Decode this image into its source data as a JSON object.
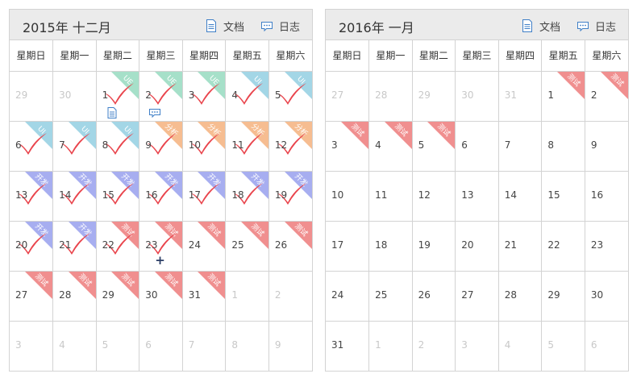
{
  "colors": {
    "UE": "#a6e0c9",
    "UI": "#a3d6e6",
    "分析": "#f6bd91",
    "开发": "#a7aef0",
    "测试": "#f08f8f",
    "check": "#e9444c"
  },
  "icons": {
    "document": "document-icon",
    "log": "chat-bubble-icon",
    "check": "check-mark-icon",
    "plus": "plus-icon"
  },
  "weekdays": [
    "星期日",
    "星期一",
    "星期二",
    "星期三",
    "星期四",
    "星期五",
    "星期六"
  ],
  "calendars": [
    {
      "title": "2015年 十二月",
      "doc_label": "文档",
      "log_label": "日志",
      "weeks": [
        [
          {
            "d": "29",
            "other": true
          },
          {
            "d": "30",
            "other": true
          },
          {
            "d": "1",
            "tag": "UE",
            "check": true,
            "doc": true
          },
          {
            "d": "2",
            "tag": "UE",
            "check": true,
            "log": true
          },
          {
            "d": "3",
            "tag": "UE",
            "check": true
          },
          {
            "d": "4",
            "tag": "UI",
            "check": true
          },
          {
            "d": "5",
            "tag": "UI",
            "check": true
          }
        ],
        [
          {
            "d": "6",
            "tag": "UI",
            "check": true
          },
          {
            "d": "7",
            "tag": "UI",
            "check": true
          },
          {
            "d": "8",
            "tag": "UI",
            "check": true
          },
          {
            "d": "9",
            "tag": "分析",
            "check": true
          },
          {
            "d": "10",
            "tag": "分析",
            "check": true
          },
          {
            "d": "11",
            "tag": "分析",
            "check": true
          },
          {
            "d": "12",
            "tag": "分析",
            "check": true
          }
        ],
        [
          {
            "d": "13",
            "tag": "开发",
            "check": true
          },
          {
            "d": "14",
            "tag": "开发",
            "check": true
          },
          {
            "d": "15",
            "tag": "开发",
            "check": true
          },
          {
            "d": "16",
            "tag": "开发",
            "check": true
          },
          {
            "d": "17",
            "tag": "开发",
            "check": true
          },
          {
            "d": "18",
            "tag": "开发",
            "check": true
          },
          {
            "d": "19",
            "tag": "开发",
            "check": true
          }
        ],
        [
          {
            "d": "20",
            "tag": "开发",
            "check": true
          },
          {
            "d": "21",
            "tag": "开发",
            "check": true
          },
          {
            "d": "22",
            "tag": "测试",
            "check": true
          },
          {
            "d": "23",
            "tag": "测试",
            "check": true,
            "plus": true
          },
          {
            "d": "24",
            "tag": "测试"
          },
          {
            "d": "25",
            "tag": "测试"
          },
          {
            "d": "26",
            "tag": "测试"
          }
        ],
        [
          {
            "d": "27",
            "tag": "测试"
          },
          {
            "d": "28",
            "tag": "测试"
          },
          {
            "d": "29",
            "tag": "测试"
          },
          {
            "d": "30",
            "tag": "测试"
          },
          {
            "d": "31",
            "tag": "测试"
          },
          {
            "d": "1",
            "other": true
          },
          {
            "d": "2",
            "other": true
          }
        ],
        [
          {
            "d": "3",
            "other": true
          },
          {
            "d": "4",
            "other": true
          },
          {
            "d": "5",
            "other": true
          },
          {
            "d": "6",
            "other": true
          },
          {
            "d": "7",
            "other": true
          },
          {
            "d": "8",
            "other": true
          },
          {
            "d": "9",
            "other": true
          }
        ]
      ]
    },
    {
      "title": "2016年 一月",
      "doc_label": "文档",
      "log_label": "日志",
      "weeks": [
        [
          {
            "d": "27",
            "other": true
          },
          {
            "d": "28",
            "other": true
          },
          {
            "d": "29",
            "other": true
          },
          {
            "d": "30",
            "other": true
          },
          {
            "d": "31",
            "other": true
          },
          {
            "d": "1",
            "tag": "测试"
          },
          {
            "d": "2",
            "tag": "测试"
          }
        ],
        [
          {
            "d": "3",
            "tag": "测试"
          },
          {
            "d": "4",
            "tag": "测试"
          },
          {
            "d": "5",
            "tag": "测试"
          },
          {
            "d": "6"
          },
          {
            "d": "7"
          },
          {
            "d": "8"
          },
          {
            "d": "9"
          }
        ],
        [
          {
            "d": "10"
          },
          {
            "d": "11"
          },
          {
            "d": "12"
          },
          {
            "d": "13"
          },
          {
            "d": "14"
          },
          {
            "d": "15"
          },
          {
            "d": "16"
          }
        ],
        [
          {
            "d": "17"
          },
          {
            "d": "18"
          },
          {
            "d": "19"
          },
          {
            "d": "20"
          },
          {
            "d": "21"
          },
          {
            "d": "22"
          },
          {
            "d": "23"
          }
        ],
        [
          {
            "d": "24"
          },
          {
            "d": "25"
          },
          {
            "d": "26"
          },
          {
            "d": "27"
          },
          {
            "d": "28"
          },
          {
            "d": "29"
          },
          {
            "d": "30"
          }
        ],
        [
          {
            "d": "31"
          },
          {
            "d": "1",
            "other": true
          },
          {
            "d": "2",
            "other": true
          },
          {
            "d": "3",
            "other": true
          },
          {
            "d": "4",
            "other": true
          },
          {
            "d": "5",
            "other": true
          },
          {
            "d": "6",
            "other": true
          }
        ]
      ]
    }
  ]
}
